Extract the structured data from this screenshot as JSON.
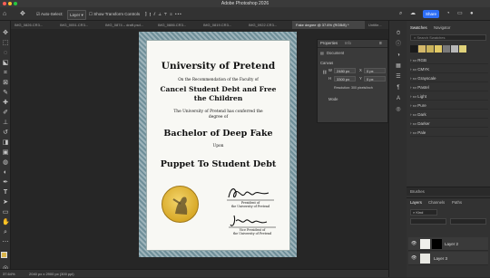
{
  "app": {
    "title": "Adobe Photoshop 2026"
  },
  "options_bar": {
    "auto_select": "Auto-Select:",
    "layer_select": "Layer",
    "show_transform": "Show Transform Controls",
    "share": "Share"
  },
  "tabs": [
    {
      "label": "IMG_0826.CR3..."
    },
    {
      "label": "IMG_0051.CR3..."
    },
    {
      "label": "IMG_0874 – draft.psd..."
    },
    {
      "label": "IMG_0886.CR3..."
    },
    {
      "label": "IMG_0819.CR3..."
    },
    {
      "label": "IMG_0922.CR3..."
    },
    {
      "label": "Fake degree @ 37.6% (RGB/8) *"
    },
    {
      "label": "Untitle..."
    }
  ],
  "certificate": {
    "title": "University of Pretend",
    "line1": "On the Recommendation of the Faculty of",
    "faculty_1": "Cancel Student Debt and Free",
    "faculty_2": "the Children",
    "conferred_1": "The University of Pretend has conferred the",
    "conferred_2": "degree of",
    "degree": "Bachelor of Deep Fake",
    "upon": "Upon",
    "recipient": "Puppet To Student Debt",
    "sig1_title": "President of",
    "sig1_org": "the University of Pretend",
    "sig2_title": "Vice President of",
    "sig2_org": "the University of Pretend"
  },
  "status": {
    "zoom": "37.64%",
    "size": "2040 px x 2900 px (300 ppi)"
  },
  "properties": {
    "tab_properties": "Properties",
    "tab_info": "Info",
    "document": "Document",
    "canvas": "Canvas",
    "w_label": "W",
    "w_value": "2480 px",
    "h_label": "H",
    "h_value": "3300 px",
    "x_label": "X",
    "x_value": "0 px",
    "y_label": "Y",
    "y_value": "0 px",
    "resolution": "Resolution: 300 pixels/inch",
    "mode": "Mode"
  },
  "swatches": {
    "tab_swatches": "Swatches",
    "tab_navigator": "Navigator",
    "search_placeholder": "Search Swatches",
    "colors": [
      "#1a1a1a",
      "#d4b86a",
      "#c9b25c",
      "#e1c965",
      "#7a7a7a",
      "#b8b8b8",
      "#e0d27a"
    ],
    "folders": [
      "RGB",
      "CMYK",
      "Grayscale",
      "Pastel",
      "Light",
      "Pure",
      "Dark",
      "Darker",
      "Pale"
    ]
  },
  "brushes": {
    "label": "Brushes"
  },
  "layers": {
    "tab_layers": "Layers",
    "tab_channels": "Channels",
    "tab_paths": "Paths",
    "kind": "Kind",
    "items": [
      {
        "name": "Layer 2"
      },
      {
        "name": "Layer 3"
      }
    ]
  }
}
